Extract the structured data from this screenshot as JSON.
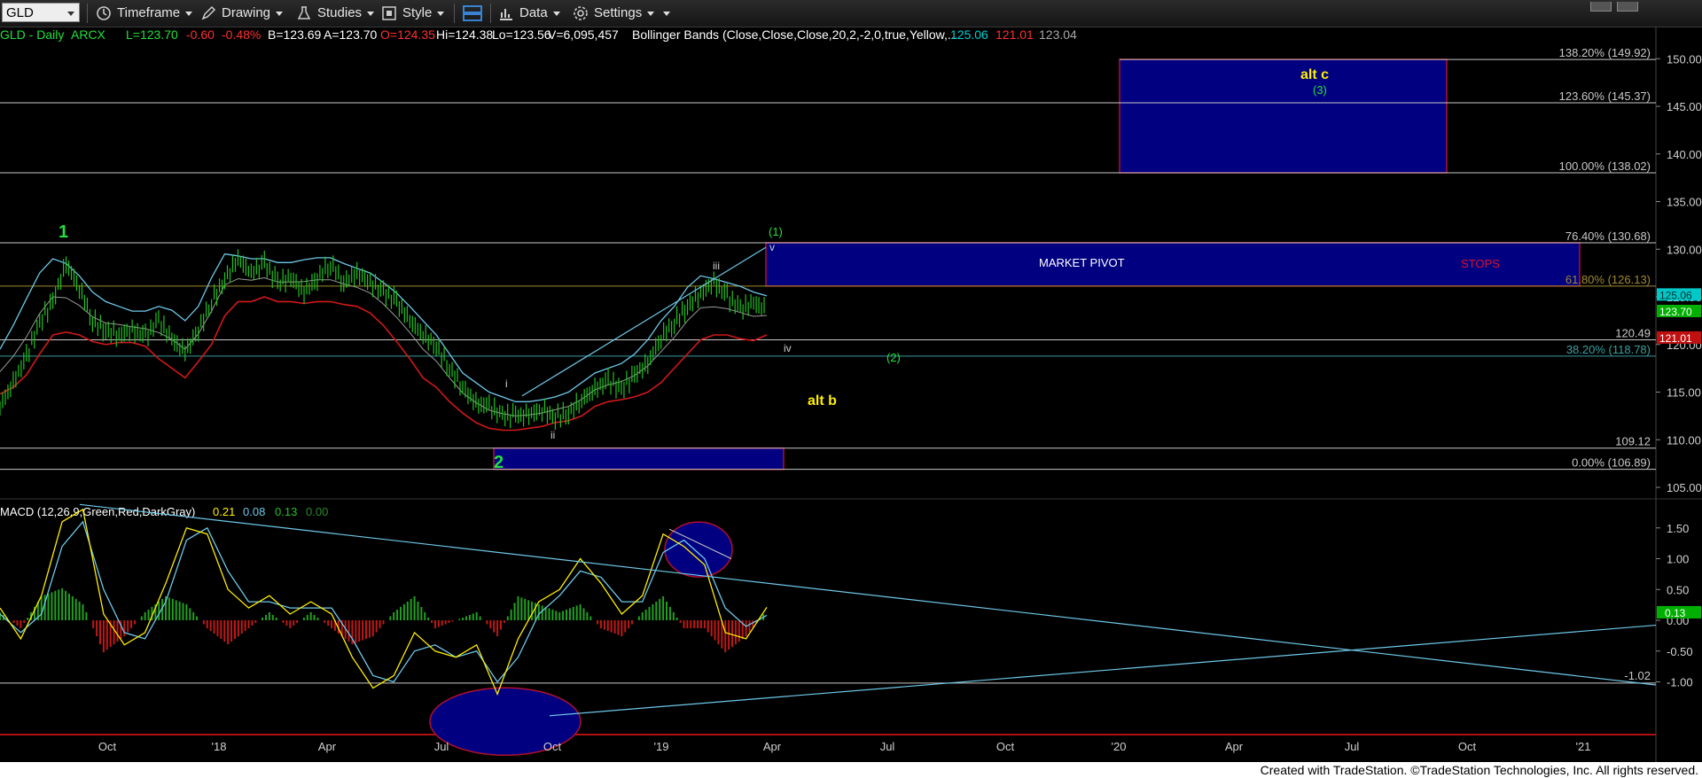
{
  "toolbar": {
    "symbol": "GLD",
    "menus": [
      "Timeframe",
      "Drawing",
      "Studies",
      "Style",
      "Data",
      "Settings"
    ]
  },
  "header": {
    "instrument": "GLD - Daily",
    "exchange": "ARCX",
    "last": "L=123.70",
    "change": "-0.60",
    "change_pct": "-0.48%",
    "bid": "B=123.69",
    "ask": "A=123.70",
    "open": "O=124.35",
    "high": "Hi=124.38",
    "low": "Lo=123.56",
    "volume": "V=6,095,457",
    "study": "Bollinger Bands (Close,Close,Close,20,2,-2,0,true,Yellow,...",
    "bb_upper": "125.06",
    "bb_lower": "121.01",
    "bb_mid": "123.04"
  },
  "macd_header": {
    "label": "MACD (12,26,9,Green,Red,DarkGray)",
    "v1": "0.21",
    "v2": "0.08",
    "v3": "0.13",
    "v4": "0.00"
  },
  "chart_data": [
    {
      "type": "line",
      "title": "GLD - Daily",
      "x": [
        "Oct",
        "'18",
        "Apr",
        "Jul",
        "Oct",
        "'19",
        "Apr",
        "Jul",
        "Oct",
        "'20",
        "Apr",
        "Jul",
        "Oct",
        "'21"
      ],
      "ylim": [
        102.5,
        152.5
      ],
      "y_ticks": [
        "150.00",
        "145.00",
        "140.00",
        "135.00",
        "130.00",
        "125.00",
        "120.00",
        "115.00",
        "110.00",
        "105.00"
      ],
      "series": [
        {
          "name": "Close",
          "values": [
            113.5,
            116,
            118.7,
            122.3,
            124.5,
            128.5,
            126,
            122.5,
            121.5,
            121,
            121.5,
            120.8,
            122.5,
            120.5,
            119.2,
            121.5,
            124.5,
            126.8,
            129,
            127.5,
            128.5,
            126.5,
            127,
            125.5,
            127,
            128.5,
            126.5,
            127.5,
            126.5,
            125.5,
            124.5,
            122.5,
            121,
            119.8,
            117.5,
            115.5,
            113.8,
            113.5,
            112.5,
            112.5,
            112.6,
            113.2,
            112.4,
            112.8,
            114.2,
            115.3,
            116.2,
            115.3,
            116.8,
            118,
            120.8,
            122.3,
            124,
            125.4,
            126.5,
            125,
            123.7,
            124.3,
            123.7
          ]
        },
        {
          "name": "BB Upper",
          "values": [
            119.5,
            122,
            124.8,
            127.5,
            129,
            128.5,
            127.2,
            125.5,
            124.5,
            124,
            123.5,
            123.5,
            124,
            123.6,
            122.5,
            124,
            127,
            129.5,
            129.3,
            129,
            129,
            128.6,
            128.6,
            128.9,
            129.1,
            129.1,
            128.5,
            128,
            127.5,
            126.5,
            125.4,
            124,
            122.5,
            121,
            119,
            117,
            116,
            115,
            114.5,
            114,
            114,
            114.2,
            114.5,
            115,
            116,
            117,
            117.5,
            118,
            119,
            120.5,
            122.5,
            124,
            126,
            127.2,
            126.9,
            126.5,
            126.1,
            125.5,
            125.1
          ]
        },
        {
          "name": "BB Lower",
          "values": [
            114.8,
            115.5,
            116.8,
            119,
            121,
            121.3,
            121,
            120.3,
            120,
            120.2,
            120.2,
            119.8,
            118.5,
            117.5,
            116.5,
            118.2,
            120,
            123,
            124.5,
            124.5,
            125,
            124.5,
            124.5,
            124.3,
            124.5,
            124.5,
            124.2,
            124,
            123.3,
            122,
            120.3,
            118.5,
            116.5,
            115.5,
            114,
            112.8,
            111.8,
            111.2,
            111,
            111,
            111.2,
            111.4,
            111.8,
            112,
            112.5,
            113.5,
            114,
            114.2,
            114.5,
            115,
            116,
            117.5,
            119,
            120.5,
            121,
            121,
            120.6,
            120.4,
            121
          ]
        }
      ],
      "horizontal_levels": [
        {
          "label": "138.20% (149.92)",
          "value": 149.92
        },
        {
          "label": "123.60% (145.37)",
          "value": 145.37
        },
        {
          "label": "100.00% (138.02)",
          "value": 138.02
        },
        {
          "label": "76.40% (130.68)",
          "value": 130.68
        },
        {
          "label": "61.80% (126.13)",
          "value": 126.13
        },
        {
          "label": "120.49",
          "value": 120.49
        },
        {
          "label": "38.20% (118.78)",
          "value": 118.78
        },
        {
          "label": "109.12",
          "value": 109.12
        },
        {
          "label": "0.00% (106.89)",
          "value": 106.89
        }
      ],
      "price_tags": [
        {
          "value": "125.06",
          "color": "#00c8c8"
        },
        {
          "value": "123.70",
          "color": "#00b000"
        },
        {
          "value": "121.01",
          "color": "#c01010"
        }
      ],
      "boxes": [
        {
          "name": "alt-c-target-box",
          "y_range": [
            138.02,
            149.92
          ]
        },
        {
          "name": "market-pivot-box",
          "y_range": [
            126.13,
            130.68
          ],
          "label": "MARKET PIVOT",
          "label2": "STOPS"
        },
        {
          "name": "wave-2-support-box",
          "y_range": [
            106.89,
            109.12
          ]
        }
      ],
      "annotations": [
        "1",
        "2",
        "(1)",
        "(2)",
        "(3)",
        "i",
        "ii",
        "iii",
        "iv",
        "v",
        "alt b",
        "alt c"
      ],
      "grid": false,
      "legend": "none"
    },
    {
      "type": "line",
      "title": "MACD (12,26,9,Green,Red,DarkGray)",
      "ylim": [
        -1.5,
        2.0
      ],
      "y_ticks": [
        "1.50",
        "1.00",
        "0.50",
        "0.00",
        "-0.50",
        "-1.00"
      ],
      "series": [
        {
          "name": "MACD",
          "values": [
            0.2,
            -0.3,
            0.4,
            1.6,
            1.8,
            0.1,
            -0.4,
            -0.2,
            0.6,
            1.5,
            1.4,
            0.5,
            0.2,
            0.4,
            0.1,
            0.3,
            0.1,
            -0.6,
            -1.1,
            -0.9,
            -0.2,
            -0.5,
            -0.6,
            -0.4,
            -1.2,
            -0.3,
            0.3,
            0.5,
            1.0,
            0.6,
            0.1,
            0.4,
            1.4,
            1.2,
            0.9,
            -0.2,
            -0.3,
            0.21
          ]
        },
        {
          "name": "Signal",
          "values": [
            0.1,
            -0.2,
            0.1,
            1.2,
            1.6,
            0.5,
            -0.2,
            -0.3,
            0.3,
            1.3,
            1.5,
            0.8,
            0.3,
            0.3,
            0.2,
            0.2,
            0.2,
            -0.3,
            -0.9,
            -1.0,
            -0.5,
            -0.4,
            -0.6,
            -0.5,
            -1.0,
            -0.6,
            0.1,
            0.4,
            0.8,
            0.7,
            0.3,
            0.3,
            1.1,
            1.3,
            1.0,
            0.2,
            -0.1,
            0.08
          ]
        }
      ],
      "histogram_last": 0.13,
      "horizontal_levels": [
        {
          "label": "-1.02",
          "value": -1.02
        }
      ],
      "price_tags": [
        {
          "value": "0.13",
          "color": "#00b000"
        }
      ]
    }
  ],
  "footer": "Created with TradeStation. ©TradeStation Technologies, Inc. All rights reserved."
}
